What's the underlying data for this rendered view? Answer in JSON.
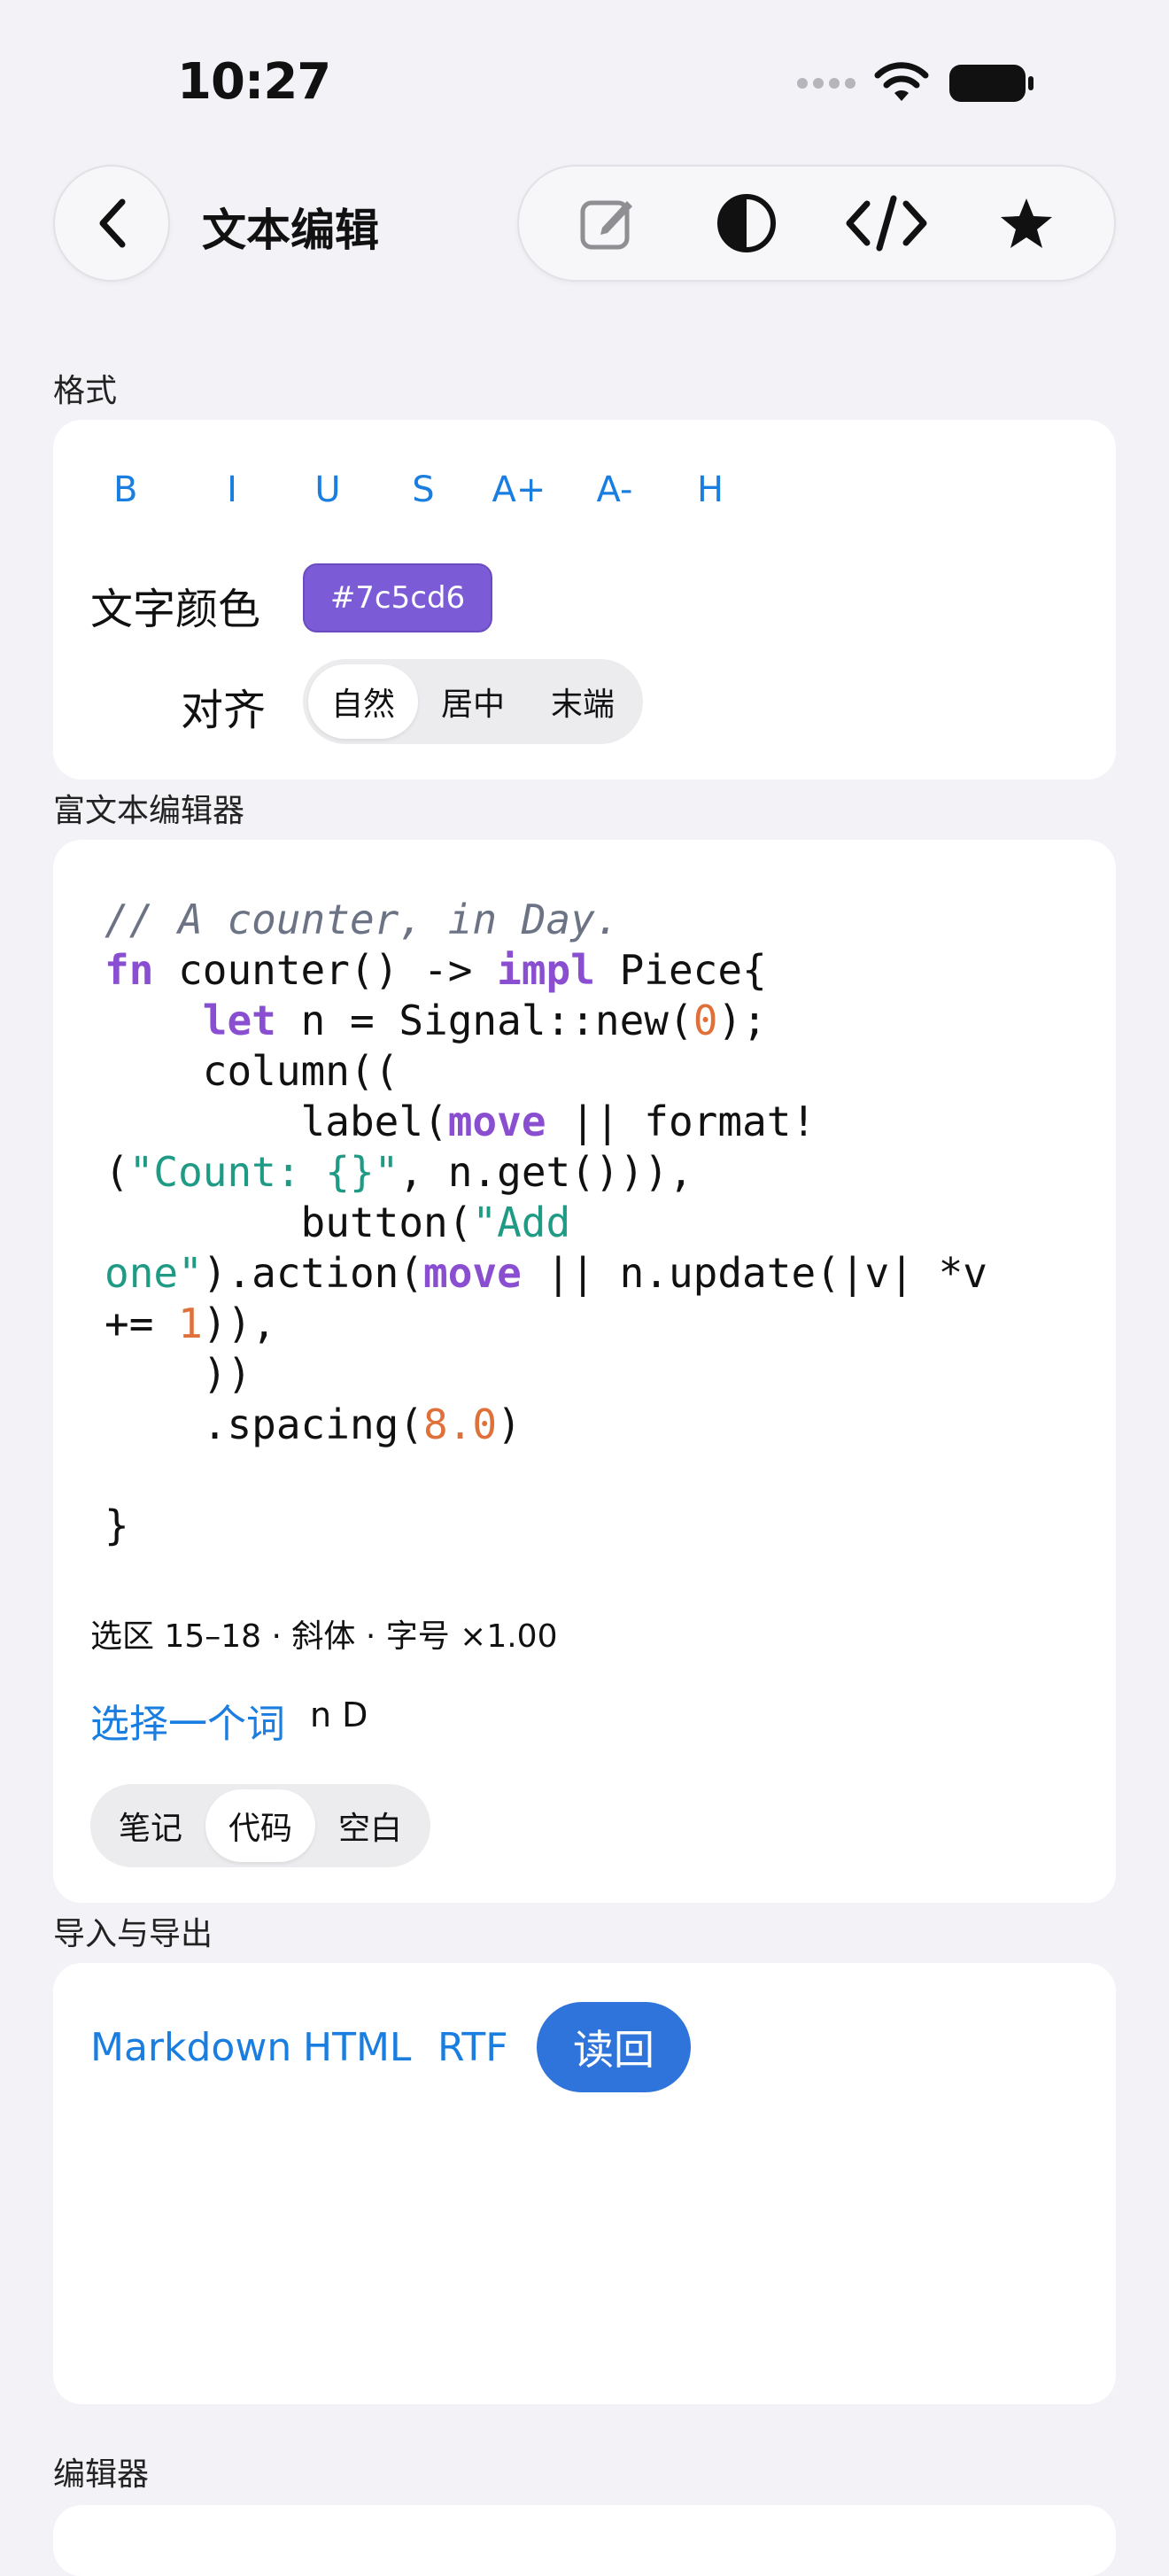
{
  "status": {
    "time": "10:27"
  },
  "nav": {
    "title": "文本编辑"
  },
  "toolbar": {
    "icons": [
      "edit-icon",
      "contrast-icon",
      "code-icon",
      "star-icon"
    ]
  },
  "format": {
    "section_label": "格式",
    "buttons": [
      "B",
      "I",
      "U",
      "S",
      "A+",
      "A-",
      "H"
    ],
    "color_label": "文字颜色",
    "color_value": "#7c5cd6",
    "align_label": "对齐",
    "align_options": [
      "自然",
      "居中",
      "末端"
    ],
    "align_selected": "自然"
  },
  "rich_editor": {
    "section_label": "富文本编辑器",
    "code_lines": [
      "// A counter, in Day.",
      "fn counter() -> impl Piece{",
      "    let n = Signal::new(0);",
      "    column((",
      "        label(move || format!",
      "(\"Count: {}\", n.get())),",
      "        button(\"Add",
      "one\").action(move || n.update(|v| *v",
      "+= 1)),",
      "    ))",
      "    .spacing(8.0)",
      "",
      "}"
    ],
    "selection_info": "选区 15–18 · 斜体 · 字号 ×1.00",
    "pick_word_label": "选择一个词",
    "picked_word": "n D",
    "mode_options": [
      "笔记",
      "代码",
      "空白"
    ],
    "mode_selected": "代码"
  },
  "export": {
    "section_label": "导入与导出",
    "links": [
      "Markdown",
      "HTML",
      "RTF"
    ],
    "read_back_label": "读回"
  },
  "editor": {
    "section_label": "编辑器"
  }
}
